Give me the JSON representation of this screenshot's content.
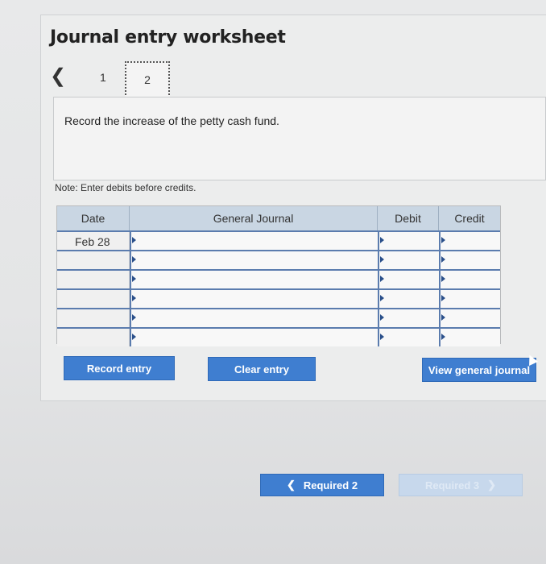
{
  "worksheet": {
    "title": "Journal entry worksheet",
    "pagination": {
      "prev_icon": "chevron-left-icon",
      "pages": [
        "1",
        "2"
      ],
      "current_page": "2"
    },
    "instruction": "Record the increase of the petty cash fund.",
    "note": "Note: Enter debits before credits."
  },
  "journal_table": {
    "headers": {
      "date": "Date",
      "general_journal": "General Journal",
      "debit": "Debit",
      "credit": "Credit"
    },
    "rows": [
      {
        "date": "Feb 28",
        "account": "",
        "debit": "",
        "credit": ""
      },
      {
        "date": "",
        "account": "",
        "debit": "",
        "credit": ""
      },
      {
        "date": "",
        "account": "",
        "debit": "",
        "credit": ""
      },
      {
        "date": "",
        "account": "",
        "debit": "",
        "credit": ""
      },
      {
        "date": "",
        "account": "",
        "debit": "",
        "credit": ""
      },
      {
        "date": "",
        "account": "",
        "debit": "",
        "credit": ""
      }
    ]
  },
  "buttons": {
    "record_entry": "Record entry",
    "clear_entry": "Clear entry",
    "view_general_journal": "View general journal",
    "required_2": "Required 2",
    "required_3": "Required 3"
  },
  "colors": {
    "button_blue": "#3f7ed0",
    "header_blue": "#c9d6e3",
    "row_border": "#5b7cae"
  }
}
